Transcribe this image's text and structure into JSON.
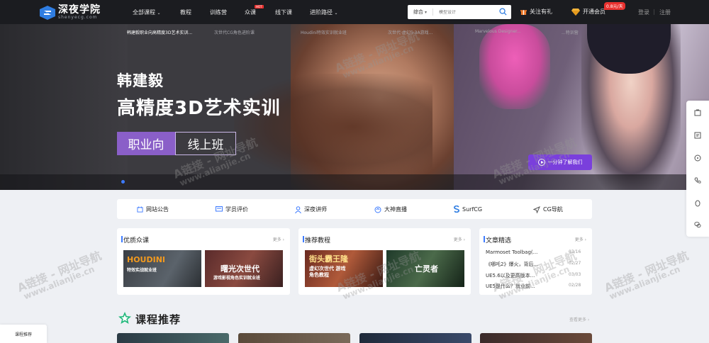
{
  "brand": {
    "name": "深夜学院",
    "sub": "shenyecg.com"
  },
  "nav": {
    "items": [
      {
        "label": "全部课程",
        "has_caret": true
      },
      {
        "label": "教程"
      },
      {
        "label": "训练营"
      },
      {
        "label": "众课",
        "hot": "HOT"
      },
      {
        "label": "线下课"
      },
      {
        "label": "进阶路径",
        "has_caret": true
      }
    ],
    "search": {
      "category": "综合",
      "placeholder": "模型设计"
    },
    "follow": "关注有礼",
    "vip": "开通会员",
    "vip_badge": "0.8元/天",
    "login": "登录",
    "sep": "|",
    "register": "注册"
  },
  "banner": {
    "line1": "韩建毅",
    "line2": "高精度3D艺术实训",
    "tag1": "职业向",
    "tag2": "线上班",
    "cta": "一分钟了解我们",
    "strip": [
      "韩建毅职业向高精度3D艺术实训...",
      "次世代CG角色进阶课",
      "Houdini特效实训就业班",
      "次世代·虚幻5·3A游戏...",
      "Marvelous Designer...",
      "...特训营"
    ]
  },
  "features": [
    {
      "label": "网站公告",
      "icon": "announcement-icon"
    },
    {
      "label": "学员评价",
      "icon": "review-icon"
    },
    {
      "label": "深夜讲师",
      "icon": "teacher-icon"
    },
    {
      "label": "大神直播",
      "icon": "live-icon"
    },
    {
      "label": "SurfCG",
      "icon": "surfcg-icon"
    },
    {
      "label": "CG导航",
      "icon": "navigation-icon"
    }
  ],
  "cards": {
    "crowd": {
      "title": "优质众课",
      "more": "更多 ›",
      "thumbs": [
        {
          "line1": "HOUDINI",
          "line2": "特效实战就业班"
        },
        {
          "line1": "曙光次世代",
          "line2": "游戏影视角色实训就业班"
        }
      ]
    },
    "recommend": {
      "title": "推荐教程",
      "more": "更多 ›",
      "thumbs": [
        {
          "line1": "街头霸王隆",
          "line2": "虚幻次世代 游戏角色教程"
        },
        {
          "line1": "亡灵者",
          "line2": ""
        }
      ]
    },
    "articles": {
      "title": "文章精选",
      "more": "更多 ›",
      "items": [
        {
          "title": "Marmoset Toolbag(...",
          "date": "03/16"
        },
        {
          "title": "《哪吒2》爆火，背后...",
          "date": "02/27"
        },
        {
          "title": "UE5.6以及更高版本...",
          "date": "03/03"
        },
        {
          "title": "UE5是什么？就业前...",
          "date": "02/28"
        }
      ]
    }
  },
  "courses": {
    "title": "课程推荐",
    "more": "查看更多 ›"
  },
  "float_tag": "课程推荐",
  "watermark": [
    "A链接 - 网址导航",
    "www.alianjie.cn"
  ],
  "colors": {
    "accent": "#3d7bff",
    "purple": "#8a5fc8",
    "hot": "#e8312f",
    "nav_bg": "#1b1c20"
  }
}
